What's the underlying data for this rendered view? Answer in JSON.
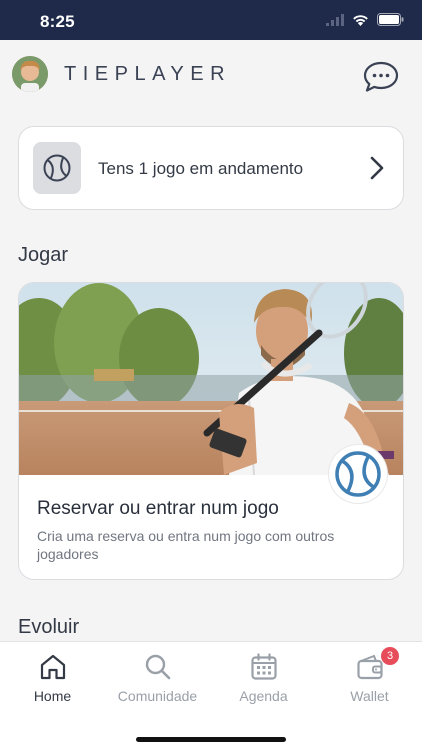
{
  "status_bar": {
    "time": "8:25"
  },
  "header": {
    "brand": "TIEPLAYER"
  },
  "in_progress": {
    "text": "Tens 1 jogo em andamento"
  },
  "sections": {
    "play_title": "Jogar",
    "evolve_title": "Evoluir"
  },
  "play_card": {
    "title": "Reservar ou entrar num jogo",
    "description": "Cria uma reserva ou entra num jogo com outros jogadores"
  },
  "tab_bar": {
    "tabs": [
      {
        "label": "Home",
        "icon": "home-icon",
        "active": true
      },
      {
        "label": "Comunidade",
        "icon": "search-icon",
        "active": false
      },
      {
        "label": "Agenda",
        "icon": "calendar-icon",
        "active": false
      },
      {
        "label": "Wallet",
        "icon": "wallet-icon",
        "active": false,
        "badge": "3"
      }
    ]
  },
  "colors": {
    "status_bar": "#1f2a4a",
    "accent_blue": "#3f7fb4",
    "badge_red": "#e74c5b",
    "background": "#f4f4f5"
  }
}
